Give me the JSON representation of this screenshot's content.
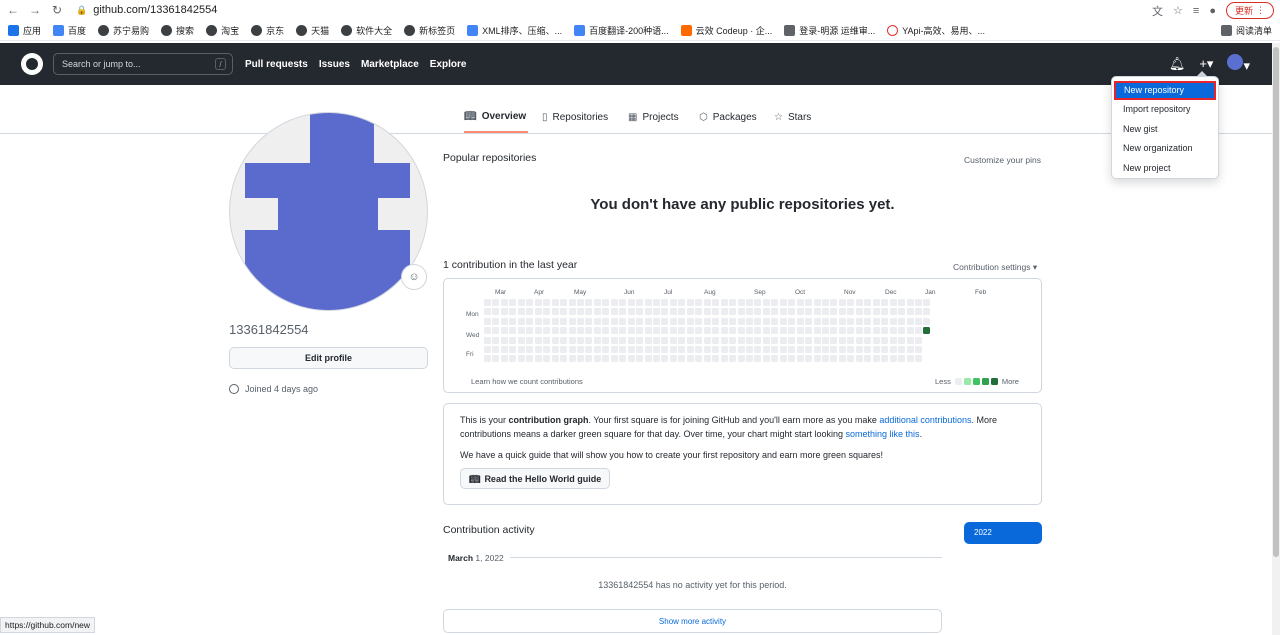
{
  "browser": {
    "url": "github.com/13361842554",
    "update_label": "更新",
    "bookmarks": [
      {
        "label": "应用",
        "icon": "apps-icon"
      },
      {
        "label": "百度",
        "icon": "baidu-icon"
      },
      {
        "label": "苏宁易购",
        "icon": "globe-icon"
      },
      {
        "label": "搜索",
        "icon": "globe-icon"
      },
      {
        "label": "淘宝",
        "icon": "globe-icon"
      },
      {
        "label": "京东",
        "icon": "globe-icon"
      },
      {
        "label": "天猫",
        "icon": "globe-icon"
      },
      {
        "label": "软件大全",
        "icon": "globe-icon"
      },
      {
        "label": "新标签页",
        "icon": "globe-icon"
      },
      {
        "label": "XML排序、压缩、...",
        "icon": "xml-icon"
      },
      {
        "label": "百度翻译-200种语...",
        "icon": "translate-icon"
      },
      {
        "label": "云效 Codeup · 企...",
        "icon": "codeup-icon"
      },
      {
        "label": "登录-明源 运维审...",
        "icon": "shield-icon"
      },
      {
        "label": "YApi-高效、易用、...",
        "icon": "yapi-icon"
      }
    ],
    "reading_list": "阅读清单",
    "status_url": "https://github.com/new"
  },
  "header": {
    "search_placeholder": "Search or jump to...",
    "search_key": "/",
    "nav": [
      "Pull requests",
      "Issues",
      "Marketplace",
      "Explore"
    ]
  },
  "tabs": [
    {
      "label": "Overview",
      "icon": "book-icon"
    },
    {
      "label": "Repositories",
      "icon": "repo-icon"
    },
    {
      "label": "Projects",
      "icon": "table-icon"
    },
    {
      "label": "Packages",
      "icon": "package-icon"
    },
    {
      "label": "Stars",
      "icon": "star-icon"
    }
  ],
  "profile": {
    "username": "13361842554",
    "edit_label": "Edit profile",
    "joined": "Joined 4 days ago"
  },
  "popular": {
    "title": "Popular repositories",
    "customize": "Customize your pins",
    "empty": "You don't have any public repositories yet."
  },
  "contrib": {
    "title": "1 contribution in the last year",
    "settings": "Contribution settings ▾",
    "months": [
      "Mar",
      "Apr",
      "May",
      "Jun",
      "Jul",
      "Aug",
      "Sep",
      "Oct",
      "Nov",
      "Dec",
      "Jan",
      "Feb"
    ],
    "days": [
      "Mon",
      "Wed",
      "Fri"
    ],
    "learn": "Learn how we count contributions",
    "less": "Less",
    "more": "More",
    "colors": [
      "#ebedf0",
      "#9be9a8",
      "#40c463",
      "#30a14e",
      "#216e39"
    ]
  },
  "info": {
    "p1_a": "This is your ",
    "p1_b": "contribution graph",
    "p1_c": ". Your first square is for joining GitHub and you'll earn more as you make ",
    "p1_link1": "additional contributions",
    "p1_d": ". More contributions means a darker green square for that day. Over time, your chart might start looking ",
    "p1_link2": "something like this",
    "p1_e": ".",
    "p2": "We have a quick guide that will show you how to create your first repository and earn more green squares!",
    "guide_btn": "Read the Hello World guide"
  },
  "activity": {
    "title": "Contribution activity",
    "year": "2022",
    "month_label": "March",
    "month_year": "1, 2022",
    "empty": "13361842554 has no activity yet for this period.",
    "show_more": "Show more activity"
  },
  "dropdown": {
    "items": [
      "New repository",
      "Import repository",
      "New gist",
      "New organization",
      "New project"
    ]
  }
}
